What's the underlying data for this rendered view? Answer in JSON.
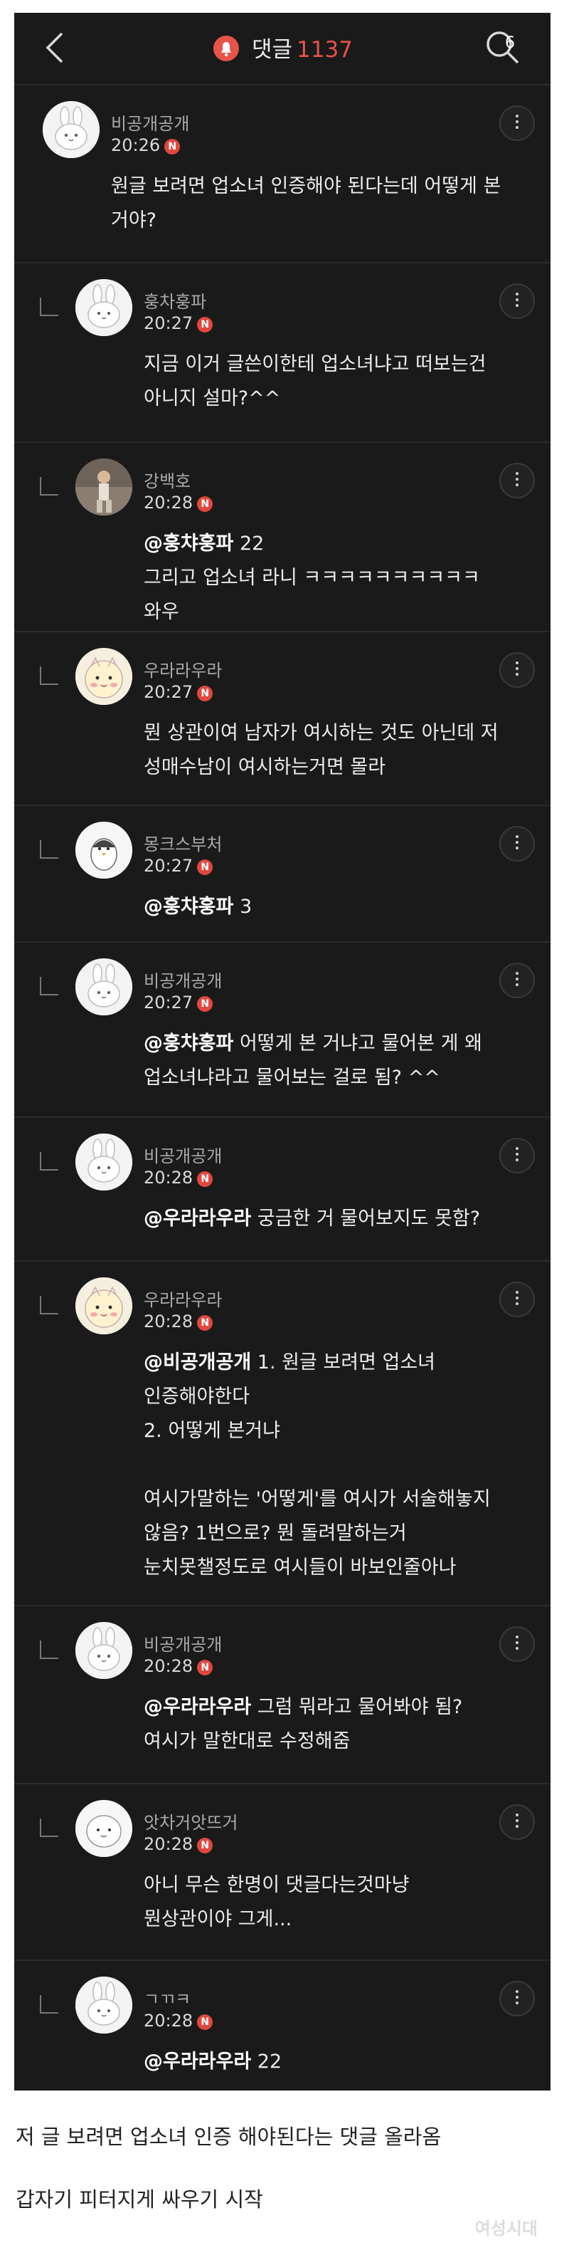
{
  "header": {
    "title": "댓글",
    "count": "1137",
    "search_badge": "6",
    "colors": {
      "accent": "#e8534a",
      "background": "#1a1a1a"
    }
  },
  "comments": [
    {
      "name": "비공개공개",
      "time": "20:26",
      "badge": "N",
      "avatar": "bunny-avatar",
      "reply": false,
      "mention": "",
      "lines": [
        "원글 보려면 업소녀 인증해야 된다는데 어떻게 본",
        "거야?"
      ]
    },
    {
      "name": "훙차훙파",
      "time": "20:27",
      "badge": "N",
      "avatar": "bunny-avatar",
      "reply": true,
      "mention": "",
      "lines": [
        "지금 이거 글쓴이한테 업소녀냐고 떠보는건",
        "아니지 설마?^^"
      ]
    },
    {
      "name": "강백호",
      "time": "20:28",
      "badge": "N",
      "avatar": "photo-avatar",
      "reply": true,
      "mention": "@훙챠훙파",
      "lines": [
        " 22",
        "그리고 업소녀 라니 ㅋㅋㅋㅋㅋㅋㅋㅋㅋㅋ",
        "와우"
      ]
    },
    {
      "name": "우라라우라",
      "time": "20:27",
      "badge": "N",
      "avatar": "character-avatar",
      "reply": true,
      "mention": "",
      "lines": [
        "뭔 상관이여 남자가 여시하는 것도 아닌데 저",
        "성매수남이 여시하는거면 몰라"
      ]
    },
    {
      "name": "몽크스부처",
      "time": "20:27",
      "badge": "N",
      "avatar": "penguin-avatar",
      "reply": true,
      "mention": "@훙챠훙파",
      "lines": [
        " 3"
      ]
    },
    {
      "name": "비공개공개",
      "time": "20:27",
      "badge": "N",
      "avatar": "bunny-avatar",
      "reply": true,
      "mention": "@훙챠훙파",
      "lines": [
        " 어떻게 본 거냐고 물어본 게 왜",
        "업소녀냐라고 물어보는 걸로 됨? ^^"
      ]
    },
    {
      "name": "비공개공개",
      "time": "20:28",
      "badge": "N",
      "avatar": "bunny-avatar",
      "reply": true,
      "mention": "@우라라우라",
      "lines": [
        " 궁금한 거 물어보지도 못함?"
      ]
    },
    {
      "name": "우라라우라",
      "time": "20:28",
      "badge": "N",
      "avatar": "character-avatar",
      "reply": true,
      "mention": "@비공개공개",
      "lines": [
        " 1. 원글 보려면 업소녀",
        "인증해야한다",
        "2. 어떻게 본거냐",
        "",
        "여시가말하는 '어떻게'를 여시가 서술해놓지",
        "않음? 1번으로? 뭔 돌려말하는거",
        "눈치못챌정도로 여시들이 바보인줄아나"
      ]
    },
    {
      "name": "비공개공개",
      "time": "20:28",
      "badge": "N",
      "avatar": "bunny-avatar",
      "reply": true,
      "mention": "@우라라우라",
      "lines": [
        " 그럼 뭐라고 물어봐야 됨?",
        "여시가 말한대로 수정해줌"
      ]
    },
    {
      "name": "앗차거앗뜨거",
      "time": "20:28",
      "badge": "N",
      "avatar": "blob-avatar",
      "reply": true,
      "mention": "",
      "lines": [
        "아니 무슨 한명이 댓글다는것마냥",
        "뭔상관이야 그게..."
      ]
    },
    {
      "name": "ㄱㄲㅋ",
      "time": "20:28",
      "badge": "N",
      "avatar": "bunny-avatar",
      "reply": true,
      "mention": "@우라라우라",
      "lines": [
        " 22"
      ]
    }
  ],
  "captions": [
    "저 글 보려면 업소녀 인증 해야된다는 댓글 올라옴",
    "갑자기 피터지게 싸우기 시작"
  ]
}
